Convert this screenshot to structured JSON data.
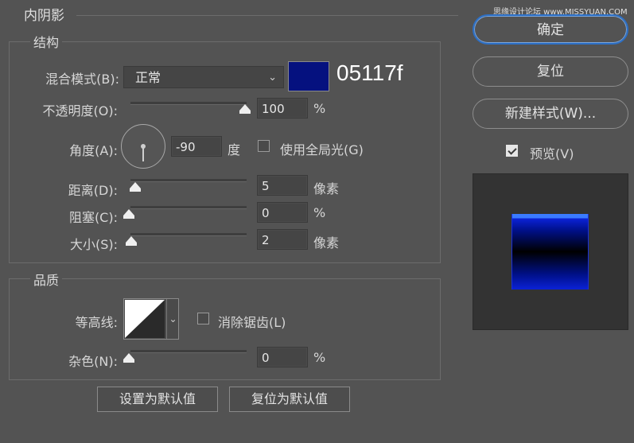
{
  "watermark": "思缘设计论坛 www.MISSYUAN.COM",
  "dialog": {
    "title": "内阴影",
    "structure": {
      "legend": "结构",
      "blend_mode": {
        "label": "混合模式(B):",
        "value": "正常",
        "color_hex": "05117f",
        "color": "#05117f"
      },
      "opacity": {
        "label": "不透明度(O):",
        "value": "100",
        "unit": "%",
        "level": 1.0
      },
      "angle": {
        "label": "角度(A):",
        "value": "-90",
        "unit": "度",
        "global_light_label": "使用全局光(G)",
        "global_light_checked": false
      },
      "distance": {
        "label": "距离(D):",
        "value": "5",
        "unit": "像素"
      },
      "choke": {
        "label": "阻塞(C):",
        "value": "0",
        "unit": "%"
      },
      "size": {
        "label": "大小(S):",
        "value": "2",
        "unit": "像素"
      }
    },
    "quality": {
      "legend": "品质",
      "contour": {
        "label": "等高线:",
        "antialias_label": "消除锯齿(L)",
        "antialias_checked": false
      },
      "noise": {
        "label": "杂色(N):",
        "value": "0",
        "unit": "%"
      }
    },
    "buttons": {
      "set_default": "设置为默认值",
      "reset_default": "复位为默认值"
    }
  },
  "side": {
    "ok": "确定",
    "reset": "复位",
    "new_style": "新建样式(W)...",
    "preview_label": "预览(V)",
    "preview_checked": true
  },
  "colors": {
    "background": "#535353",
    "accent_blue": "#2d6fc4",
    "swatch": "#05117f"
  }
}
